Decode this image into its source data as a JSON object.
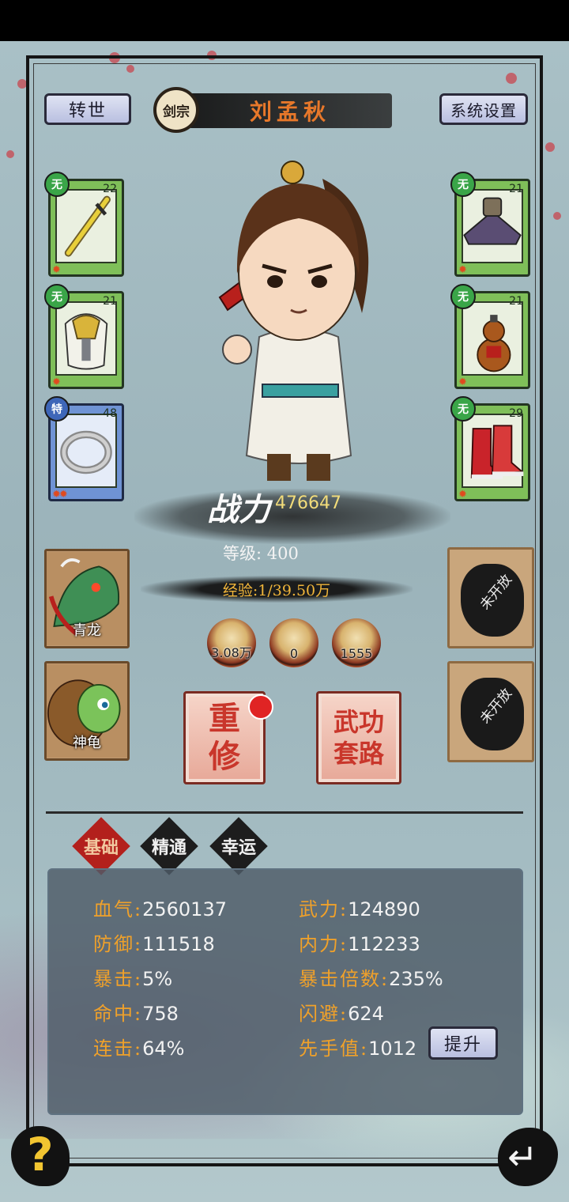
{
  "header": {
    "rebirth_label": "转世",
    "sect_label": "剑宗",
    "character_name": "刘孟秋",
    "settings_label": "系统设置"
  },
  "equipment": {
    "left": [
      {
        "tag": "无",
        "level": "22",
        "icon": "sword-icon",
        "rarity": "green"
      },
      {
        "tag": "无",
        "level": "21",
        "icon": "armor-icon",
        "rarity": "green"
      },
      {
        "tag": "特",
        "level": "48",
        "icon": "ring-icon",
        "rarity": "blue"
      }
    ],
    "right": [
      {
        "tag": "无",
        "level": "21",
        "icon": "hat-icon",
        "rarity": "green"
      },
      {
        "tag": "无",
        "level": "21",
        "icon": "gourd-icon",
        "rarity": "green"
      },
      {
        "tag": "无",
        "level": "29",
        "icon": "boots-icon",
        "rarity": "green"
      }
    ]
  },
  "power": {
    "label": "战力",
    "value": "476647"
  },
  "level": {
    "text": "等级: 400"
  },
  "experience": {
    "text": "经验:1/39.50万",
    "progress": 0.0
  },
  "currencies": [
    {
      "icon": "gold-coin-icon",
      "value": "3.08万"
    },
    {
      "icon": "pearl-icon",
      "value": "0"
    },
    {
      "icon": "jade-orb-icon",
      "value": "1555"
    }
  ],
  "pets": [
    {
      "name": "青龙",
      "icon": "dragon-icon"
    },
    {
      "name": "神龟",
      "icon": "turtle-icon"
    }
  ],
  "locked_slots": [
    {
      "label": "未开放"
    },
    {
      "label": "未开放"
    }
  ],
  "actions": {
    "retrain_label": "重修",
    "martial_arts_label": "武功套路"
  },
  "tabs": [
    {
      "label": "基础",
      "active": true
    },
    {
      "label": "精通",
      "active": false
    },
    {
      "label": "幸运",
      "active": false
    }
  ],
  "stats": {
    "left": [
      {
        "key": "血气:",
        "value": "2560137"
      },
      {
        "key": "防御:",
        "value": "111518"
      },
      {
        "key": "暴击:",
        "value": "5%"
      },
      {
        "key": "命中:",
        "value": "758"
      },
      {
        "key": "连击:",
        "value": "64%"
      }
    ],
    "right": [
      {
        "key": "武力:",
        "value": "124890"
      },
      {
        "key": "内力:",
        "value": "112233"
      },
      {
        "key": "暴击倍数:",
        "value": "235%"
      },
      {
        "key": "闪避:",
        "value": "624"
      },
      {
        "key": "先手值:",
        "value": "1012"
      }
    ],
    "upgrade_label": "提升"
  },
  "footer": {
    "help_icon": "question-icon",
    "help_glyph": "?",
    "back_icon": "back-arrow-icon",
    "back_glyph": "↵"
  },
  "colors": {
    "accent_orange": "#f0a12a",
    "name_orange": "#e8782a",
    "active_tab": "#b3201c",
    "equip_green": "#7fbf59",
    "equip_blue": "#6f93d4"
  }
}
